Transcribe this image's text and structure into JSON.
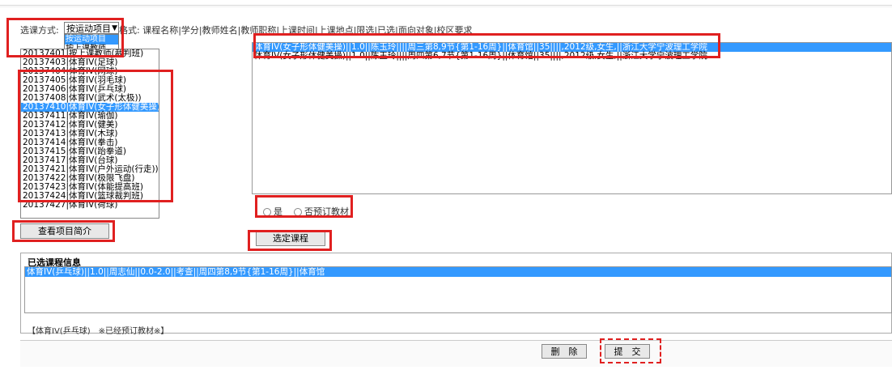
{
  "selector": {
    "label": "选课方式:",
    "selected": "按运动项目",
    "options": [
      "按运动项目",
      "按上课教师"
    ],
    "format_hint": "格式: 课程名称|学分|教师姓名|教师职称|上课时间|上课地点|限选|已选|面向对象|校区要求"
  },
  "left_list": {
    "items": [
      "20137401|按上课教师(裁判班)",
      "20137403|体育IV(足球)",
      "20137404|体育IV(网球)",
      "20137405|体育IV(羽毛球)",
      "20137406|体育IV(乒乓球)",
      "20137408|体育IV(武术(太极))",
      "20137410|体育IV(女子形体健美操)",
      "20137411|体育IV(瑜伽)",
      "20137412|体育IV(健美)",
      "20137413|体育IV(木球)",
      "20137414|体育IV(拳击)",
      "20137415|体育IV(跆拳道)",
      "20137417|体育IV(台球)",
      "20137421|体育IV(户外运动(行走))",
      "20137422|体育IV(极限飞盘)",
      "20137423|体育IV(体能提高班)",
      "20137424|体育IV(篮球裁判班)",
      "20137427|体育IV(荷球)"
    ],
    "selected_index": 6,
    "button": "查看项目简介"
  },
  "right_list": {
    "items": [
      "体育IV(女子形体健美操)||1.0||陈玉玲||||周三第8,9节{第1-16周}||体育馆||35||||,2012级,女生,||浙江大学宁波理工学院",
      "体育IV(女子形体健美操)||1.0||陈玉玲||||周四第6,7节{第1-16周}||体育馆||35||||,2012级,女生,||浙江大学宁波理工学院"
    ],
    "selected_index": 0
  },
  "textbook": {
    "yes": "是",
    "no": "否预订教材"
  },
  "select_button": "选定课程",
  "selected_panel": {
    "title": "已选课程信息",
    "items": [
      "体育IV(乒乓球)||1.0||周志仙||0.0-2.0||考查||周四第8,9节{第1-16周}||体育馆"
    ],
    "note": "【体育IV(乒乓球)　※已经预订教材※】"
  },
  "actions": {
    "delete": "删　除",
    "submit": "提　交"
  },
  "highlight_color": "#3399ff",
  "annotation_color": "#e02020"
}
